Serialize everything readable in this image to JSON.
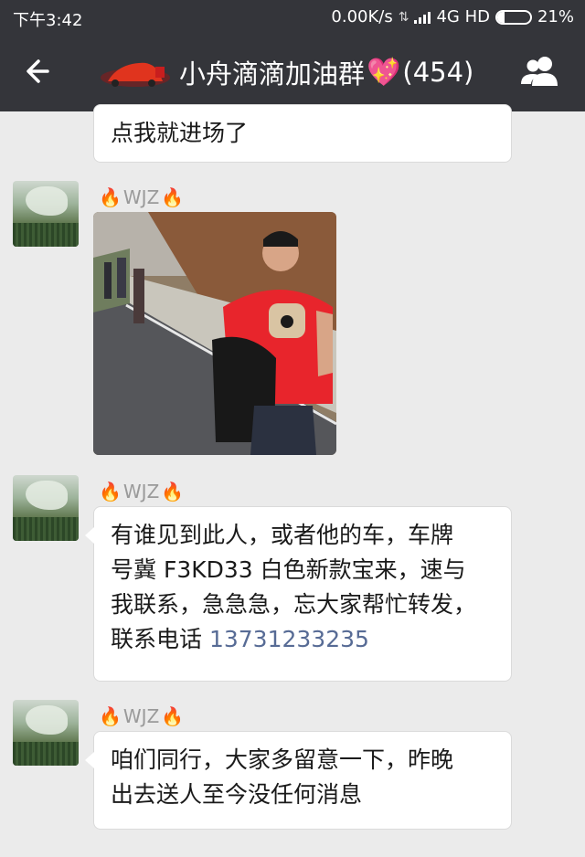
{
  "status_bar": {
    "time": "下午3:42",
    "speed": "0.00K/s",
    "network": "4G HD",
    "battery": "21%",
    "battery_level": 0.21
  },
  "header": {
    "back_icon": "arrow-left-icon",
    "group_name": "小舟滴滴加油群",
    "member_count": "(454)",
    "members_icon": "people-icon"
  },
  "messages": [
    {
      "type": "text",
      "text": "点我就进场了"
    },
    {
      "type": "image",
      "sender": "WJZ",
      "image": "photo-man-red-tshirt"
    },
    {
      "type": "text",
      "sender": "WJZ",
      "lines": [
        "有谁见到此人，或者他的车，车牌",
        "号冀 F3KD33 白色新款宝来，速与",
        "我联系，急急急，忘大家帮忙转发，"
      ],
      "last_prefix": "联系电话 ",
      "phone": "13731233235"
    },
    {
      "type": "text",
      "sender": "WJZ",
      "lines": [
        "咱们同行，大家多留意一下，昨晚",
        "出去送人至今没任何消息"
      ]
    }
  ],
  "colors": {
    "header_bg": "#34353a",
    "chat_bg": "#ebebeb",
    "link": "#576b95",
    "heart": "#ff4fa8"
  }
}
